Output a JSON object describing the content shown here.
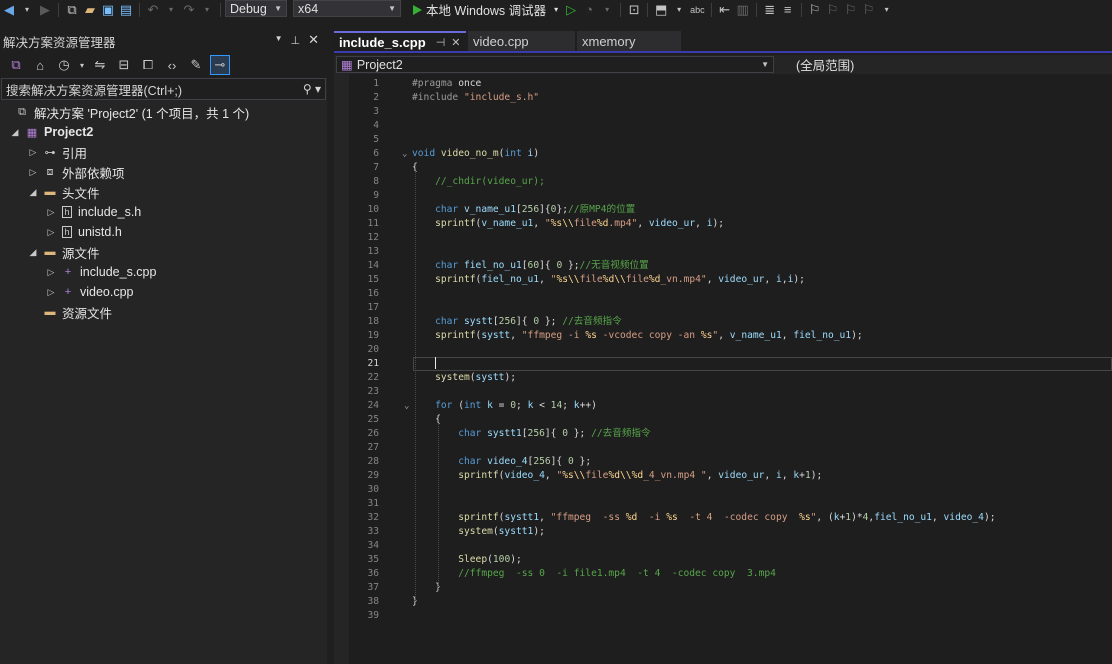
{
  "toolbar": {
    "config": "Debug",
    "platform": "x64",
    "run_label": "本地 Windows 调试器"
  },
  "solution_explorer": {
    "title": "解决方案资源管理器",
    "search_placeholder": "搜索解决方案资源管理器(Ctrl+;)",
    "tree": [
      {
        "label": "解决方案 'Project2' (1 个项目，共 1 个)",
        "depth": 0,
        "icon": "solution-icon",
        "expander": ""
      },
      {
        "label": "Project2",
        "depth": 0,
        "icon": "project-icon",
        "expander": "expanded",
        "bold": true
      },
      {
        "label": "引用",
        "depth": 1,
        "icon": "references-icon",
        "expander": "collapsed"
      },
      {
        "label": "外部依赖项",
        "depth": 1,
        "icon": "external-deps-icon",
        "expander": "collapsed"
      },
      {
        "label": "头文件",
        "depth": 1,
        "icon": "filter-folder-icon",
        "expander": "expanded"
      },
      {
        "label": "include_s.h",
        "depth": 2,
        "icon": "header-file-icon",
        "expander": "collapsed"
      },
      {
        "label": "unistd.h",
        "depth": 2,
        "icon": "header-file-icon",
        "expander": "collapsed"
      },
      {
        "label": "源文件",
        "depth": 1,
        "icon": "filter-folder-icon",
        "expander": "expanded"
      },
      {
        "label": "include_s.cpp",
        "depth": 2,
        "icon": "cpp-file-icon",
        "expander": "collapsed"
      },
      {
        "label": "video.cpp",
        "depth": 2,
        "icon": "cpp-file-icon",
        "expander": "collapsed"
      },
      {
        "label": "资源文件",
        "depth": 1,
        "icon": "filter-folder-icon",
        "expander": ""
      }
    ]
  },
  "editor": {
    "tabs": [
      {
        "label": "include_s.cpp",
        "active": true
      },
      {
        "label": "video.cpp",
        "active": false
      },
      {
        "label": "xmemory",
        "active": false
      }
    ],
    "nav_project": "Project2",
    "nav_scope": "(全局范围)",
    "current_line": 21,
    "lines": [
      {
        "n": 1,
        "t": "#pragma once"
      },
      {
        "n": 2,
        "t": "#include \"include_s.h\""
      },
      {
        "n": 3,
        "t": ""
      },
      {
        "n": 4,
        "t": ""
      },
      {
        "n": 5,
        "t": ""
      },
      {
        "n": 6,
        "t": "void video_no_m(int i)"
      },
      {
        "n": 7,
        "t": "{"
      },
      {
        "n": 8,
        "t": "    //_chdir(video_ur);"
      },
      {
        "n": 9,
        "t": ""
      },
      {
        "n": 10,
        "t": "    char v_name_u1[256]{0};//原MP4的位置"
      },
      {
        "n": 11,
        "t": "    sprintf(v_name_u1, \"%s\\\\file%d.mp4\", video_ur, i);"
      },
      {
        "n": 12,
        "t": ""
      },
      {
        "n": 13,
        "t": ""
      },
      {
        "n": 14,
        "t": "    char fiel_no_u1[60]{ 0 };//无音视频位置"
      },
      {
        "n": 15,
        "t": "    sprintf(fiel_no_u1, \"%s\\\\file%d\\\\file%d_vn.mp4\", video_ur, i,i);"
      },
      {
        "n": 16,
        "t": ""
      },
      {
        "n": 17,
        "t": ""
      },
      {
        "n": 18,
        "t": "    char systt[256]{ 0 }; //去音频指令"
      },
      {
        "n": 19,
        "t": "    sprintf(systt, \"ffmpeg -i %s -vcodec copy -an %s\", v_name_u1, fiel_no_u1);"
      },
      {
        "n": 20,
        "t": ""
      },
      {
        "n": 21,
        "t": ""
      },
      {
        "n": 22,
        "t": "    system(systt);"
      },
      {
        "n": 23,
        "t": ""
      },
      {
        "n": 24,
        "t": "    for (int k = 0; k < 14; k++)"
      },
      {
        "n": 25,
        "t": "    {"
      },
      {
        "n": 26,
        "t": "        char systt1[256]{ 0 }; //去音频指令"
      },
      {
        "n": 27,
        "t": ""
      },
      {
        "n": 28,
        "t": "        char video_4[256]{ 0 };"
      },
      {
        "n": 29,
        "t": "        sprintf(video_4, \"%s\\\\file%d\\\\%d_4_vn.mp4 \", video_ur, i, k+1);"
      },
      {
        "n": 30,
        "t": ""
      },
      {
        "n": 31,
        "t": ""
      },
      {
        "n": 32,
        "t": "        sprintf(systt1, \"ffmpeg  -ss %d  -i %s  -t 4  -codec copy  %s\", (k+1)*4,fiel_no_u1, video_4);"
      },
      {
        "n": 33,
        "t": "        system(systt1);"
      },
      {
        "n": 34,
        "t": ""
      },
      {
        "n": 35,
        "t": "        Sleep(100);"
      },
      {
        "n": 36,
        "t": "        //ffmpeg  -ss 0  -i file1.mp4  -t 4  -codec copy  3.mp4"
      },
      {
        "n": 37,
        "t": "    }"
      },
      {
        "n": 38,
        "t": "}"
      },
      {
        "n": 39,
        "t": ""
      }
    ]
  }
}
